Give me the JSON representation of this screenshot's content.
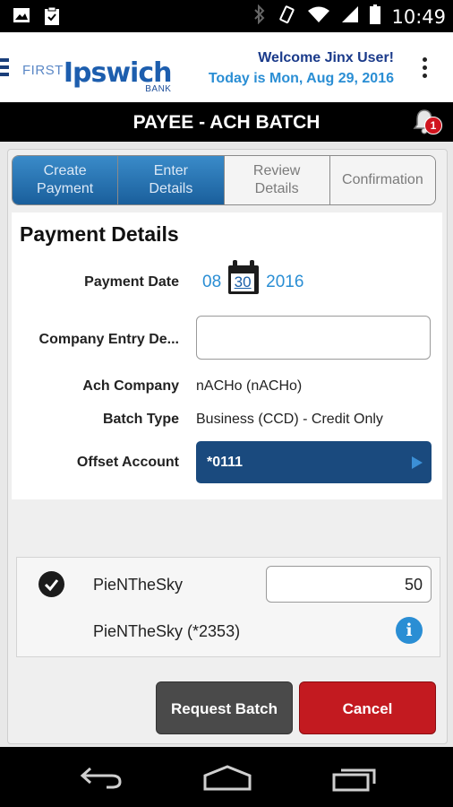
{
  "status_bar": {
    "time": "10:49"
  },
  "app_bar": {
    "logo_first": "FIRST",
    "logo_name": "Ipswich",
    "logo_bank": "BANK",
    "welcome": "Welcome Jinx User!",
    "today": "Today is Mon, Aug 29, 2016"
  },
  "title_bar": {
    "title": "PAYEE - ACH BATCH",
    "notification_count": "1"
  },
  "steps": [
    {
      "line1": "Create",
      "line2": "Payment",
      "state": "done"
    },
    {
      "line1": "Enter",
      "line2": "Details",
      "state": "active"
    },
    {
      "line1": "Review",
      "line2": "Details",
      "state": "pending"
    },
    {
      "line1": "Confirmation",
      "line2": "",
      "state": "pending"
    }
  ],
  "details": {
    "heading": "Payment Details",
    "payment_date_label": "Payment Date",
    "date_month": "08",
    "date_day": "30",
    "date_year": "2016",
    "company_entry_label": "Company Entry De...",
    "company_entry_value": "",
    "ach_company_label": "Ach Company",
    "ach_company_value": "nACHo (nACHo)",
    "batch_type_label": "Batch Type",
    "batch_type_value": "Business (CCD) - Credit Only",
    "offset_account_label": "Offset Account",
    "offset_account_value": "*0111"
  },
  "payee": {
    "name": "PieNTheSky",
    "amount": "50",
    "account": "PieNTheSky (*2353)",
    "selected": true
  },
  "actions": {
    "request": "Request Batch",
    "cancel": "Cancel"
  }
}
